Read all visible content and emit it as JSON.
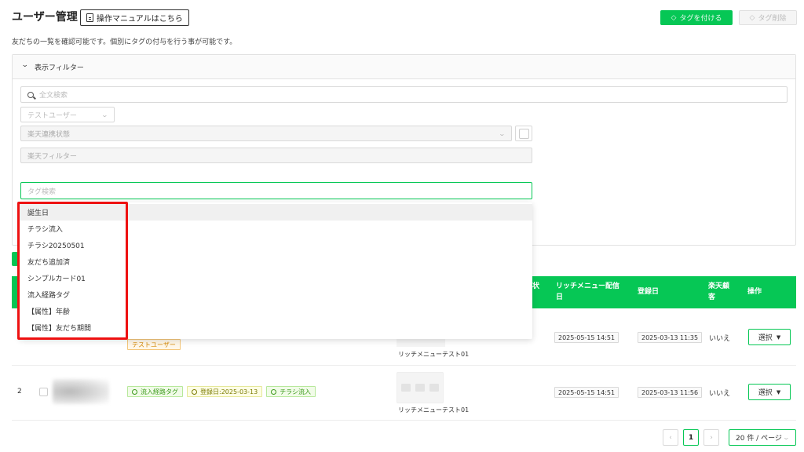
{
  "header": {
    "title": "ユーザー管理",
    "manual_button": "操作マニュアルはこちら",
    "tag_add_button": "タグを付ける",
    "tag_delete_button": "タグ削除",
    "subtitle": "友だちの一覧を確認可能です。個別にタグの付与を行う事が可能です。"
  },
  "filter": {
    "title": "表示フィルター",
    "search_placeholder": "全文検索",
    "test_user_placeholder": "テストユーザー",
    "rakuten_status_placeholder": "楽天連携状態",
    "rakuten_filter_placeholder": "楽天フィルター",
    "tag_search_placeholder": "タグ検索"
  },
  "dropdown": {
    "items": [
      "誕生日",
      "チラシ流入",
      "チラシ20250501",
      "友だち追加済",
      "シンプルカード01",
      "流入経路タグ",
      "【属性】年齢",
      "【属性】友だち期間"
    ],
    "active_index": 0
  },
  "table": {
    "headers": {
      "status_partial": "状",
      "rich_menu_line1": "リッチメニュー配信",
      "rich_menu_line2": "日",
      "registered": "登録日",
      "rakuten_line1": "楽天顧",
      "rakuten_line2": "客",
      "action": "操作"
    },
    "rows": [
      {
        "tags": [
          {
            "label": "テストユーザー",
            "style": "orange"
          }
        ],
        "rich_menu": "リッチメニューテスト01",
        "rich_menu_date": "2025-05-15 14:51",
        "registered": "2025-03-13 11:35",
        "rakuten": "いいえ",
        "action": "選択"
      },
      {
        "number": "2",
        "tags": [
          {
            "label": "流入経路タグ",
            "style": "green"
          },
          {
            "label": "登録日:2025-03-13",
            "style": "yellow"
          },
          {
            "label": "チラシ流入",
            "style": "green"
          }
        ],
        "rich_menu": "リッチメニューテスト01",
        "rich_menu_date": "2025-05-15 14:51",
        "registered": "2025-03-13 11:56",
        "rakuten": "いいえ",
        "action": "選択"
      }
    ]
  },
  "pagination": {
    "current_page": "1",
    "page_size": "20 件 / ページ"
  },
  "colors": {
    "brand_green": "#06c755",
    "highlight_red": "#ee1111"
  }
}
